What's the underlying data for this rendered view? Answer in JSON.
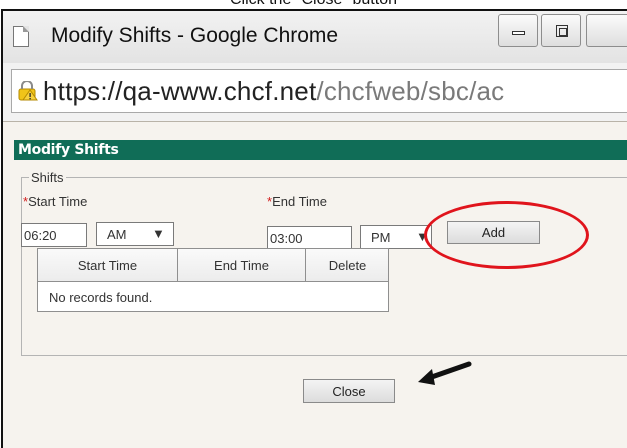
{
  "caption": "Click the \"Close\" button",
  "window": {
    "title": "Modify Shifts - Google Chrome",
    "controls": [
      "minimize-icon",
      "maximize-icon",
      "close-icon"
    ]
  },
  "address_bar": {
    "url_host": "https://qa-www.chcf.net",
    "url_path": "/chcfweb/sbc/ac",
    "icon": "lock-warning-icon"
  },
  "dialog": {
    "title": "Modify Shifts",
    "fieldset_legend": "Shifts",
    "start_time_label": "Start Time",
    "end_time_label": "End Time",
    "required_marker": "*",
    "start_time_value": "06:20",
    "start_ampm": "AM",
    "end_time_value": "03:00",
    "end_ampm": "PM",
    "add_button": "Add",
    "table": {
      "columns": [
        "Start Time",
        "End Time",
        "Delete"
      ],
      "empty_message": "No records found."
    },
    "close_button": "Close"
  },
  "annotations": {
    "highlight_color": "#e0141c",
    "header_color": "#106d57"
  }
}
